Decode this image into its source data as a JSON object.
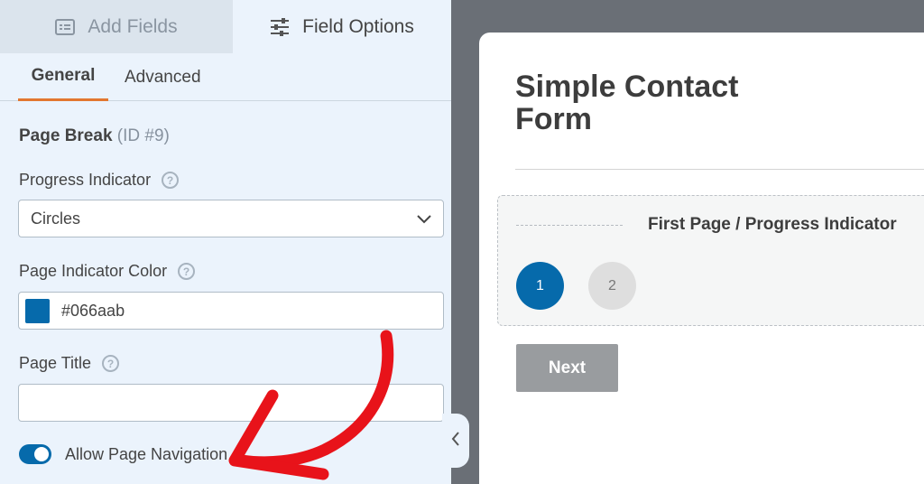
{
  "colors": {
    "accent_orange": "#e27730",
    "indicator_blue": "#066aab",
    "toggle_blue": "#066aab",
    "arrow_red": "#e8131a"
  },
  "top_tabs": {
    "add_fields": {
      "label": "Add Fields",
      "icon": "list-icon"
    },
    "field_options": {
      "label": "Field Options",
      "icon": "sliders-icon"
    }
  },
  "sub_tabs": {
    "general": "General",
    "advanced": "Advanced"
  },
  "field": {
    "name": "Page Break",
    "id": "(ID #9)"
  },
  "progress_indicator": {
    "label": "Progress Indicator",
    "value": "Circles",
    "icon": "chevron-down-icon"
  },
  "page_indicator_color": {
    "label": "Page Indicator Color",
    "value": "#066aab"
  },
  "page_title": {
    "label": "Page Title",
    "value": ""
  },
  "page_navigation": {
    "label": "Allow Page Navigation",
    "enabled": true
  },
  "help_glyph": "?",
  "preview": {
    "form_title": "Simple Contact Form",
    "page_break_label": "First Page / Progress Indicator",
    "steps": [
      "1",
      "2"
    ],
    "next_button": "Next"
  }
}
